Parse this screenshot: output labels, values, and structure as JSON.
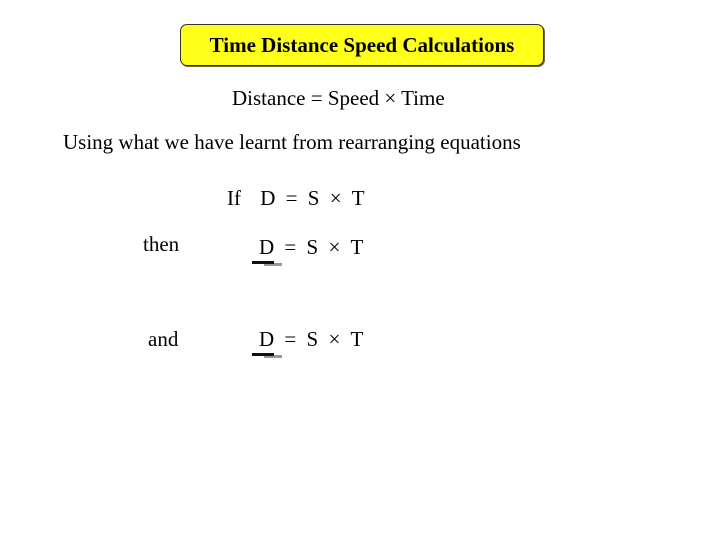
{
  "title": "Time Distance Speed Calculations",
  "formula": "Distance = Speed × Time",
  "intro": "Using what we have learnt from rearranging equations",
  "if_line": {
    "label": "If",
    "d": "D",
    "eq": "=",
    "s": "S",
    "times": "×",
    "t": "T"
  },
  "then_line": {
    "label": "then",
    "d": "D",
    "eq": "=",
    "s": "S",
    "times": "×",
    "t": "T"
  },
  "and_line": {
    "label": "and",
    "d": "D",
    "eq": "=",
    "s": "S",
    "times": "×",
    "t": "T"
  },
  "colors": {
    "title_bg": "#ffff1a"
  }
}
